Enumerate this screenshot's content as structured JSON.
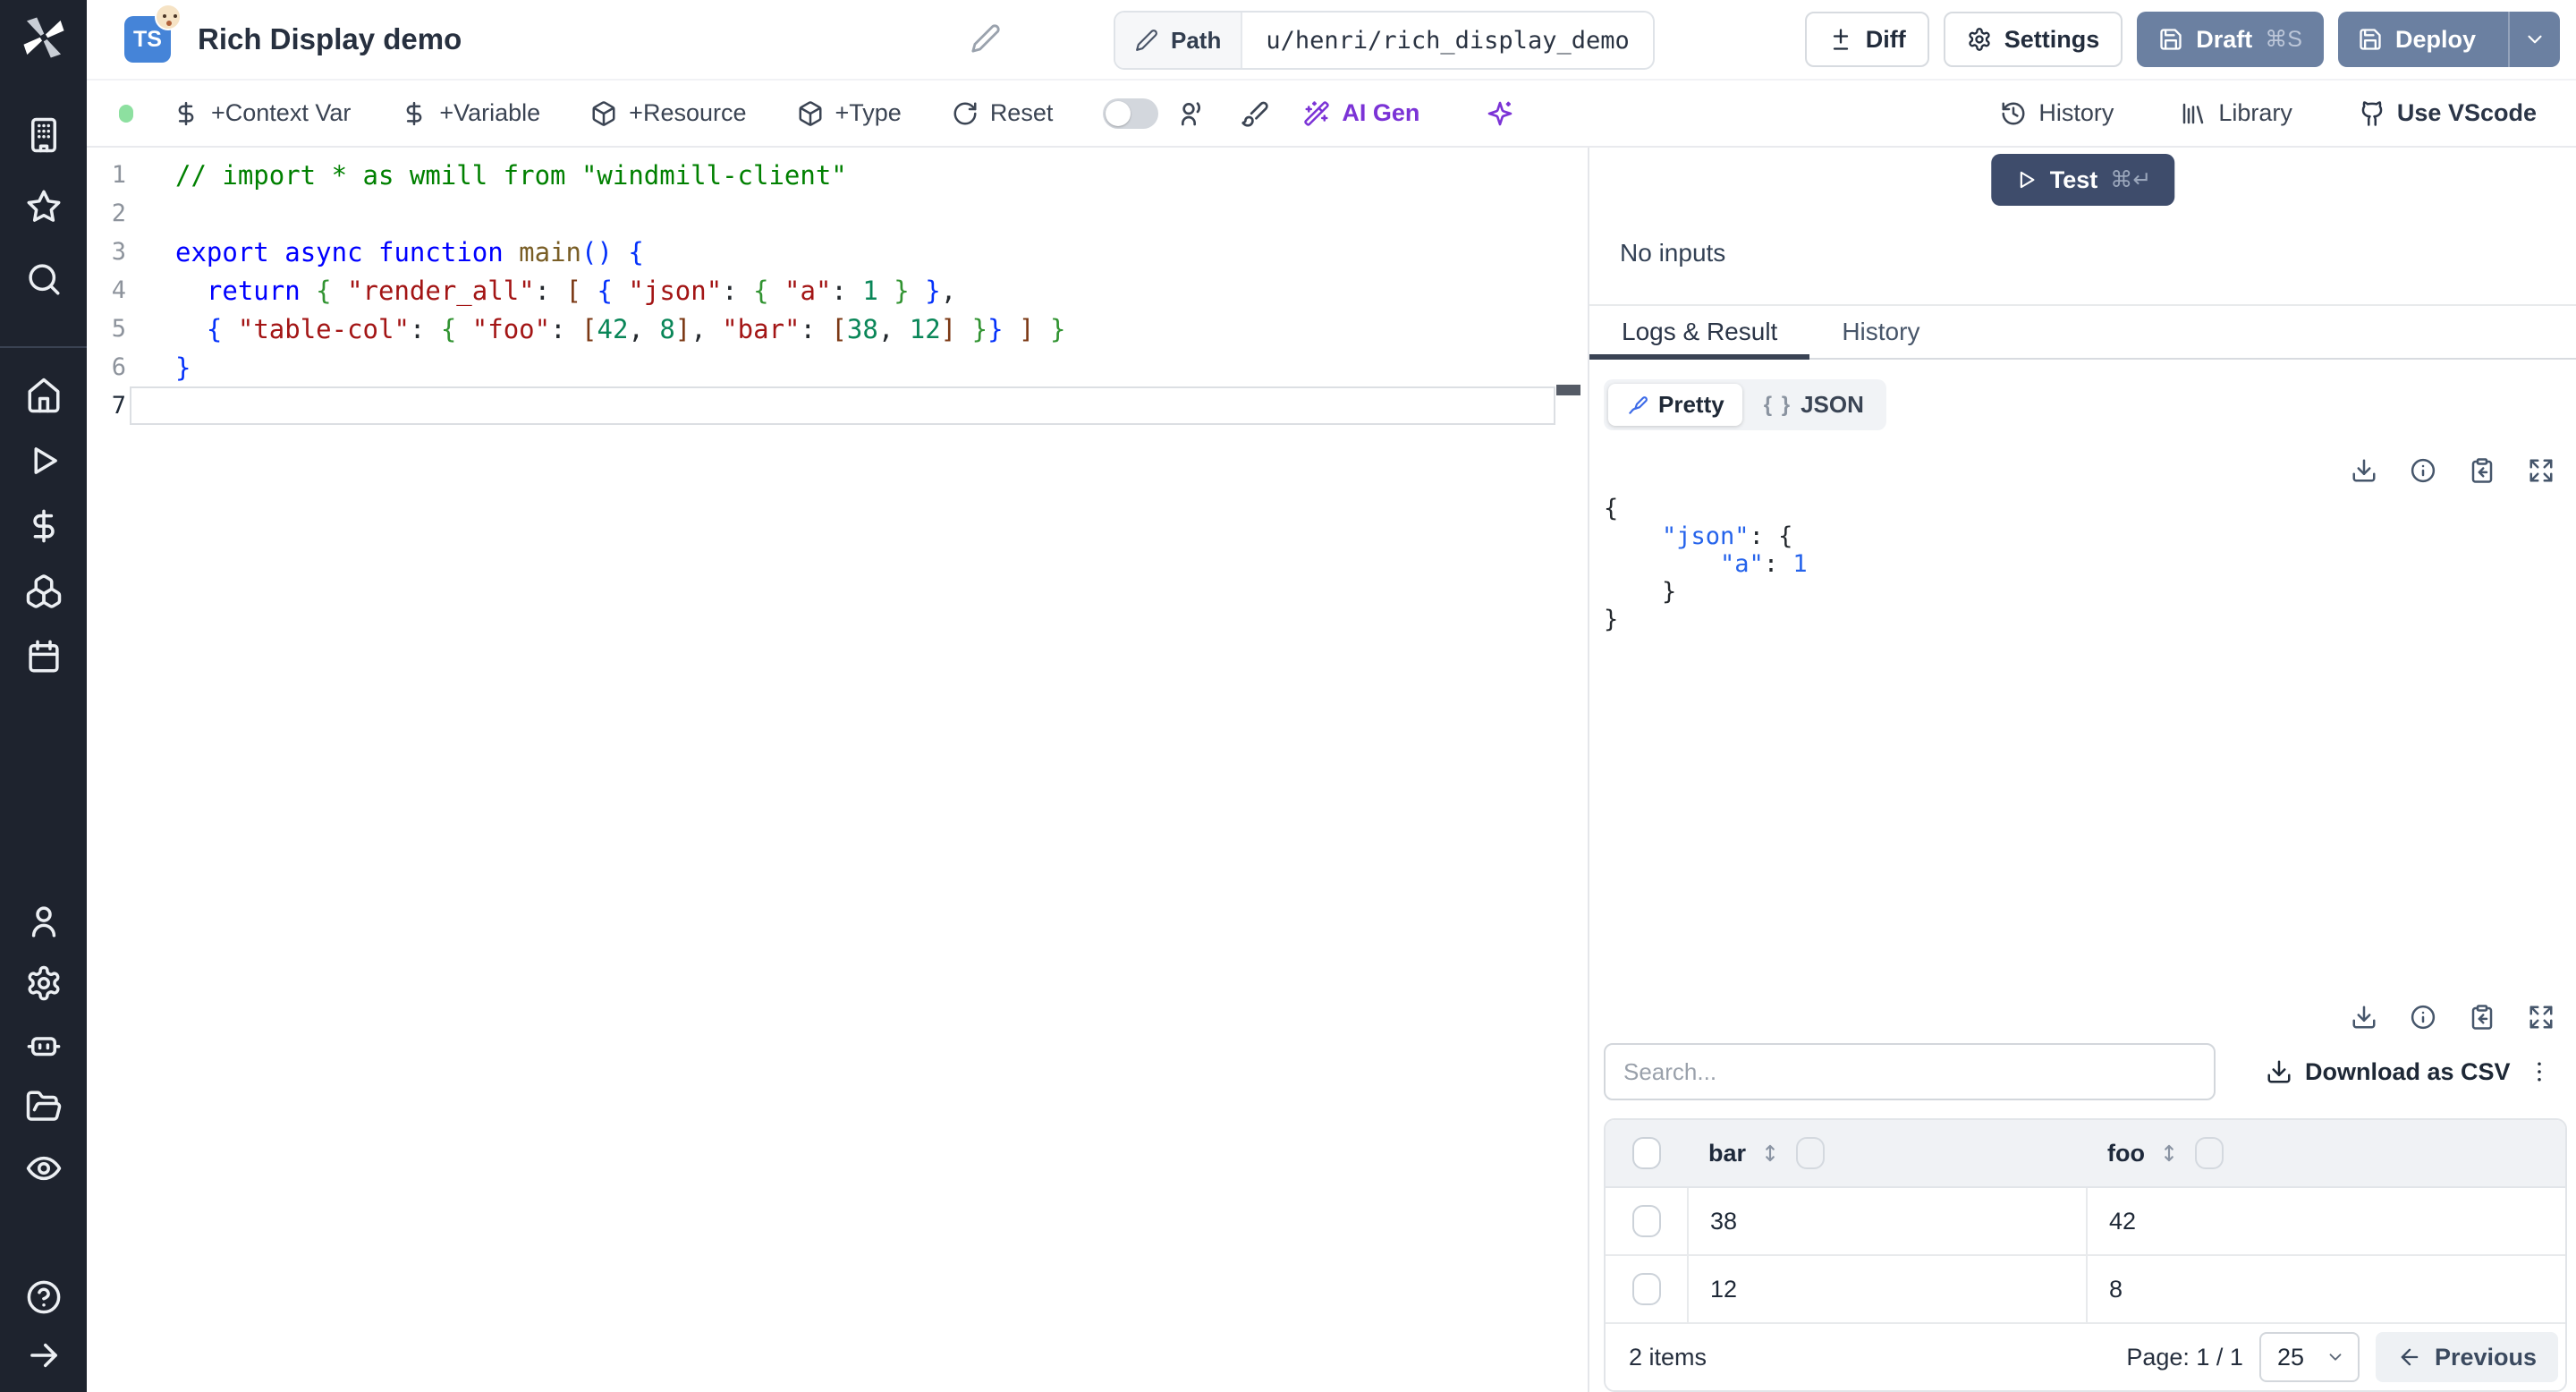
{
  "header": {
    "lang_badge": "TS",
    "title": "Rich Display demo",
    "path_label": "Path",
    "path_value": "u/henri/rich_display_demo",
    "diff_label": "Diff",
    "settings_label": "Settings",
    "draft_label": "Draft",
    "draft_shortcut": "⌘S",
    "deploy_label": "Deploy"
  },
  "toolbar": {
    "context_var": "+Context Var",
    "variable": "+Variable",
    "resource": "+Resource",
    "type": "+Type",
    "reset": "Reset",
    "ai_gen": "AI Gen",
    "history": "History",
    "library": "Library",
    "vscode": "Use VScode"
  },
  "editor": {
    "active_line": 7,
    "lines": [
      "// import * as wmill from \"windmill-client\"",
      "",
      "export async function main() {",
      "  return { \"render_all\": [ { \"json\": { \"a\": 1 } },",
      "  { \"table-col\": { \"foo\": [42, 8], \"bar\": [38, 12] }} ] }",
      "}",
      ""
    ]
  },
  "run": {
    "test_label": "Test",
    "test_shortcut": "⌘↵",
    "no_inputs": "No inputs"
  },
  "tabs": {
    "logs_result": "Logs & Result",
    "history": "History",
    "active": "Logs & Result"
  },
  "result_view": {
    "pretty_label": "Pretty",
    "json_label": "JSON",
    "json_glyph": "{ }",
    "selected": "Pretty",
    "lines": [
      "{",
      "    \"json\": {",
      "        \"a\": 1",
      "    }",
      "}"
    ]
  },
  "table": {
    "search_placeholder": "Search...",
    "download_csv": "Download as CSV",
    "columns": [
      "bar",
      "foo"
    ],
    "rows": [
      [
        "38",
        "42"
      ],
      [
        "12",
        "8"
      ]
    ],
    "footer": {
      "items": "2 items",
      "page": "Page: 1 / 1",
      "page_size": "25",
      "previous": "Previous"
    }
  },
  "icons": {
    "sidebar": [
      "windmill-logo",
      "workspace-icon",
      "favorites-star-icon",
      "search-icon",
      "home-icon",
      "runs-play-icon",
      "variables-dollar-icon",
      "resources-boxes-icon",
      "schedules-calendar-icon",
      "user-icon",
      "settings-gear-icon",
      "workers-robot-icon",
      "folders-icon",
      "audit-eye-icon",
      "help-icon",
      "expand-sidebar-arrow-icon"
    ],
    "header": [
      "edit-pencil-icon",
      "path-pencil-icon",
      "diff-icon",
      "settings-gear-icon",
      "save-icon",
      "chevron-down-icon"
    ],
    "toolbar": [
      "status-dot",
      "dollar-icon",
      "box-icon",
      "reset-icon",
      "toggle",
      "collab-users-icon",
      "format-brush-icon",
      "ai-wand-icon",
      "sparkles-icon",
      "history-clock-icon",
      "library-icon",
      "github-icon"
    ],
    "result": [
      "play-icon",
      "pen-icon",
      "braces-icon",
      "download-icon",
      "info-icon",
      "clipboard-copy-icon",
      "expand-icon",
      "search-input",
      "kebab-menu-icon",
      "sort-arrows-icon",
      "arrow-left-icon",
      "chevron-down-icon"
    ]
  },
  "colors": {
    "sidebar_bg": "#1e232e",
    "slate_button": "#6b80a1",
    "test_button": "#3e4c6b",
    "ai_purple": "#7b33d6",
    "status_green": "#8de0a0",
    "ts_badge_blue": "#4584d8",
    "code_comment": "#008000",
    "code_keyword": "#0000ff",
    "code_string": "#a31515",
    "code_number": "#098658",
    "json_value_blue": "#2563eb"
  }
}
